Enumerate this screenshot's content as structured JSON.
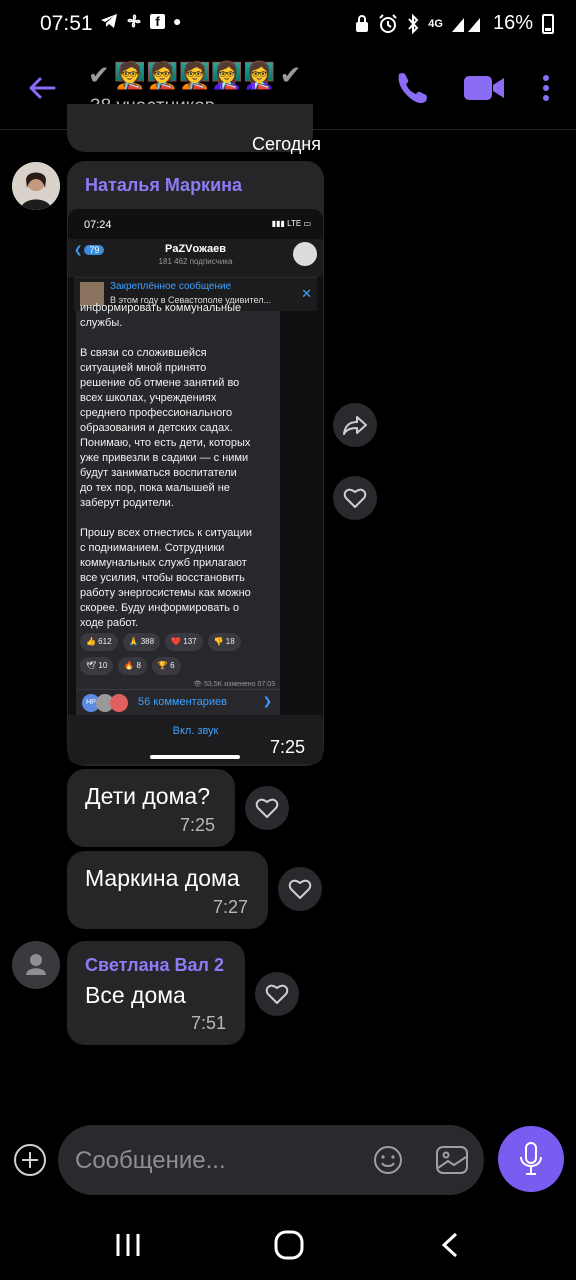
{
  "status_bar": {
    "time": "07:51",
    "battery": "16%",
    "network": "4G",
    "icons": [
      "telegram-icon",
      "fan-icon",
      "facebook-icon",
      "dot-icon",
      "lock-icon",
      "alarm-icon",
      "bluetooth-icon",
      "signal-icon",
      "battery-icon"
    ]
  },
  "header": {
    "participants": "38 участников",
    "avatar_emojis": "🧑‍🏫🧑‍🏫🧑‍🏫👩‍🏫👩‍🏫",
    "accent_color": "#8b6df5"
  },
  "conversation": {
    "date_separator": "Сегодня",
    "messages": [
      {
        "sender": "Наталья Маркина",
        "type": "image",
        "time": "7:25",
        "screenshot": {
          "status_time": "07:24",
          "status_right": "LTE",
          "back_count": "79",
          "channel_title": "PaZVожаев",
          "channel_subscribers": "181 462 подписчика",
          "pinned_label": "Закреплённое сообщение",
          "pinned_text": "В этом году в Севастополе удивител...",
          "body": "информировать коммунальные\nслужбы.\n\nВ связи со сложившейся\nситуацией мной принято\nрешение об отмене занятий во\nвсех школах, учреждениях\nсреднего профессионального\nобразования и детских садах.\nПонимаю, что есть дети, которых\nуже привезли в садики — с ними\nбудут заниматься воспитатели\nдо тех пор, пока малышей не\nзаберут родители.\n\nПрошу всех отнестись к ситуации\nс подниманием. Сотрудники\nкоммунальных служб прилагают\nвсе усилия, чтобы восстановить\nработу энергосистемы как можно\nскорее. Буду информировать о\nходе работ.",
          "reactions_row1": [
            "👍 612",
            "🙏 388",
            "❤️ 137",
            "👎 18"
          ],
          "reactions_row2": [
            "🕊 10",
            "🔥 8",
            "🏆 6"
          ],
          "views": "👁 53,5K изменено 07:03",
          "comments": "56 комментариев",
          "comment_avatar": "HP",
          "sound_button": "Вкл. звук"
        }
      },
      {
        "text": "Дети дома?",
        "time": "7:25"
      },
      {
        "text": "Маркина дома",
        "time": "7:27"
      },
      {
        "sender": "Светлана Вал 2",
        "text": "Все дома",
        "time": "7:51"
      }
    ]
  },
  "composer": {
    "placeholder": "Сообщение..."
  }
}
